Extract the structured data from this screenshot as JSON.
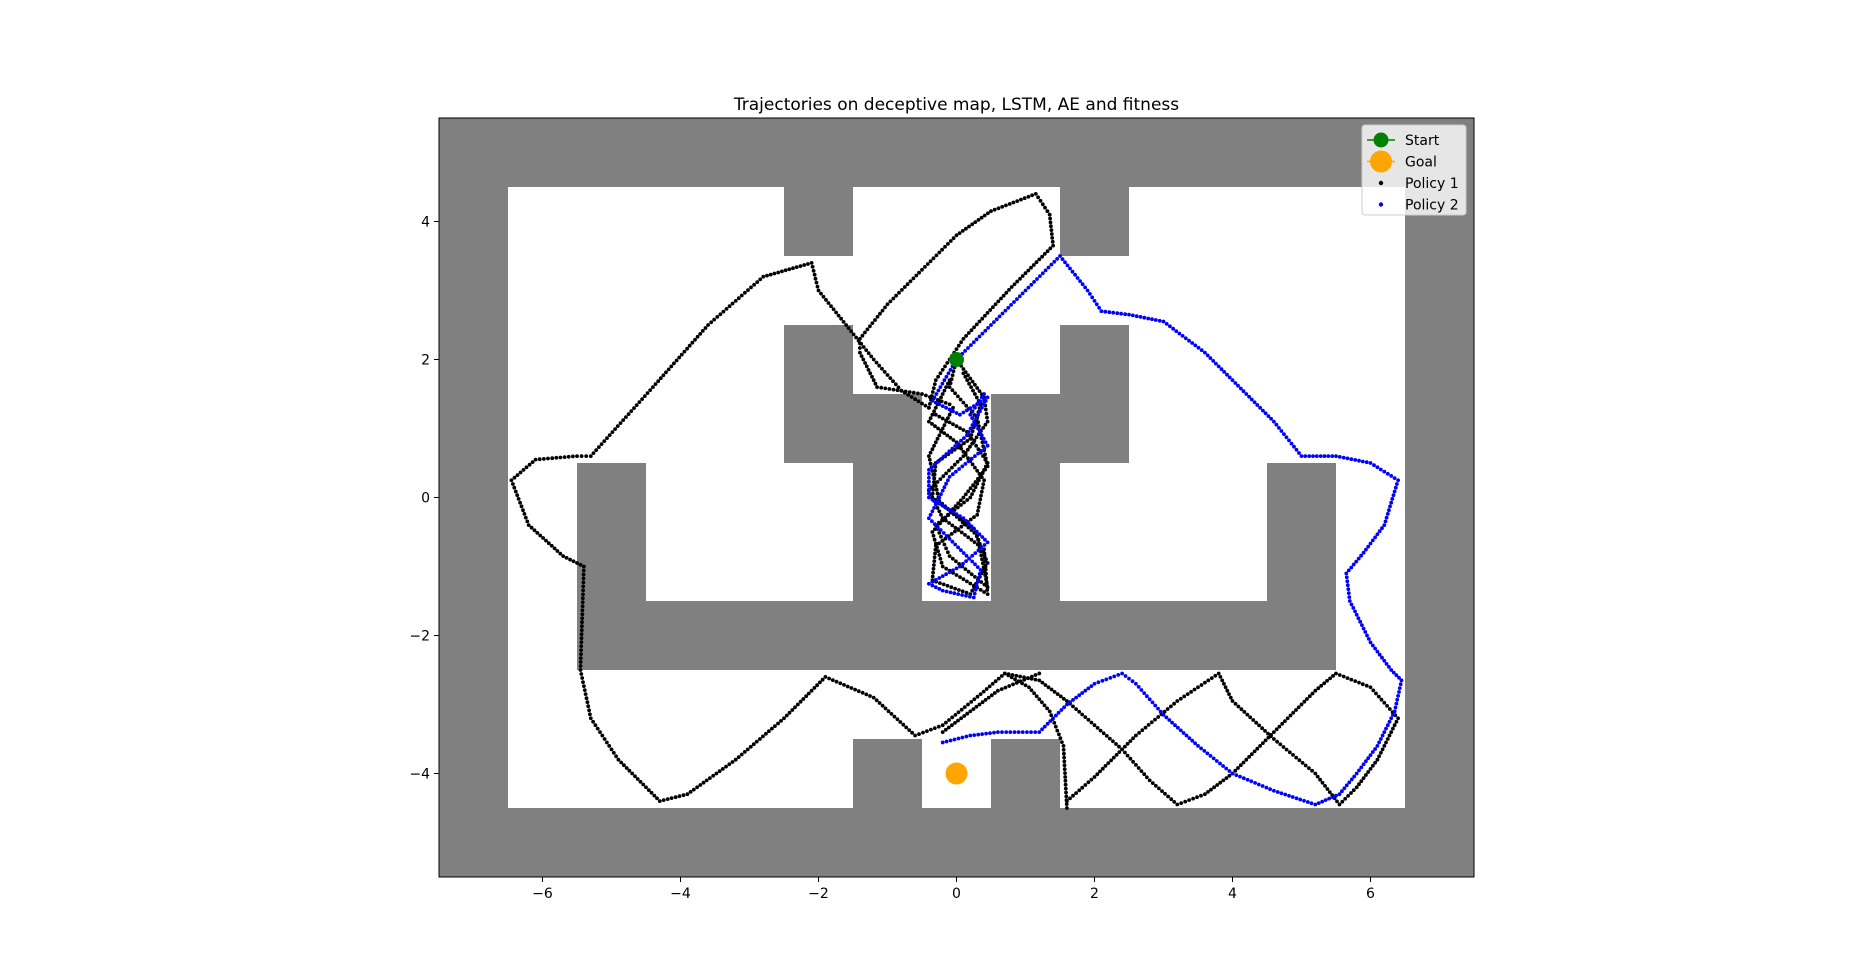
{
  "chart_data": {
    "type": "scatter",
    "title": "Trajectories on deceptive map, LSTM, AE and fitness",
    "xlabel": "",
    "ylabel": "",
    "xlim": [
      -7.5,
      7.5
    ],
    "ylim": [
      -5.5,
      5.5
    ],
    "xticks": [
      {
        "value": -6,
        "label": "−6"
      },
      {
        "value": -4,
        "label": "−4"
      },
      {
        "value": -2,
        "label": "−2"
      },
      {
        "value": 0,
        "label": "0"
      },
      {
        "value": 2,
        "label": "2"
      },
      {
        "value": 4,
        "label": "4"
      },
      {
        "value": 6,
        "label": "6"
      }
    ],
    "yticks": [
      {
        "value": -4,
        "label": "−4"
      },
      {
        "value": -2,
        "label": "−2"
      },
      {
        "value": 0,
        "label": "0"
      },
      {
        "value": 2,
        "label": "2"
      },
      {
        "value": 4,
        "label": "4"
      }
    ],
    "grid": false,
    "legend_position": "upper right",
    "colors": {
      "wall": "#808080",
      "floor": "#ffffff",
      "start": "#008000",
      "goal": "#ffa500",
      "policy1": "#000000",
      "policy2": "#0000ff"
    },
    "walls": [
      {
        "x0": -7.5,
        "x1": 7.5,
        "y0": 4.5,
        "y1": 5.5
      },
      {
        "x0": -7.5,
        "x1": 7.5,
        "y0": -5.5,
        "y1": -4.5
      },
      {
        "x0": -7.5,
        "x1": -6.5,
        "y0": -5.5,
        "y1": 5.5
      },
      {
        "x0": 6.5,
        "x1": 7.5,
        "y0": -5.5,
        "y1": 5.5
      },
      {
        "x0": -2.5,
        "x1": -1.5,
        "y0": 3.5,
        "y1": 4.5
      },
      {
        "x0": 1.5,
        "x1": 2.5,
        "y0": 3.5,
        "y1": 4.5
      },
      {
        "x0": -2.5,
        "x1": -1.5,
        "y0": 0.5,
        "y1": 2.5
      },
      {
        "x0": 1.5,
        "x1": 2.5,
        "y0": 0.5,
        "y1": 2.5
      },
      {
        "x0": -1.5,
        "x1": -0.5,
        "y0": -1.5,
        "y1": 1.5
      },
      {
        "x0": 0.5,
        "x1": 1.5,
        "y0": -1.5,
        "y1": 1.5
      },
      {
        "x0": -5.5,
        "x1": -4.5,
        "y0": -2.5,
        "y1": 0.5
      },
      {
        "x0": 4.5,
        "x1": 5.5,
        "y0": -2.5,
        "y1": 0.5
      },
      {
        "x0": -5.5,
        "x1": 5.5,
        "y0": -2.5,
        "y1": -1.5
      },
      {
        "x0": -1.5,
        "x1": -0.5,
        "y0": -4.5,
        "y1": -3.5
      },
      {
        "x0": 0.5,
        "x1": 1.5,
        "y0": -4.5,
        "y1": -3.5
      }
    ],
    "start": {
      "x": 0,
      "y": 2
    },
    "goal": {
      "x": 0,
      "y": -4
    },
    "legend": [
      {
        "label": "Start",
        "marker": "start"
      },
      {
        "label": "Goal",
        "marker": "goal"
      },
      {
        "label": "Policy 1",
        "marker": "policy1"
      },
      {
        "label": "Policy 2",
        "marker": "policy2"
      }
    ],
    "series": [
      {
        "name": "Policy 1",
        "color": "#000000",
        "trajectories": [
          [
            [
              -0.4,
              1.3
            ],
            [
              -0.8,
              1.55
            ],
            [
              -1.2,
              2.0
            ],
            [
              -2.0,
              3.0
            ],
            [
              -2.1,
              3.4
            ],
            [
              -2.8,
              3.2
            ],
            [
              -3.6,
              2.5
            ],
            [
              -4.4,
              1.6
            ],
            [
              -5.3,
              0.6
            ],
            [
              -5.5,
              0.6
            ],
            [
              -6.1,
              0.55
            ],
            [
              -6.45,
              0.25
            ],
            [
              -6.2,
              -0.4
            ],
            [
              -5.7,
              -0.85
            ],
            [
              -5.4,
              -1.0
            ],
            [
              -5.45,
              -2.5
            ],
            [
              -5.3,
              -3.2
            ],
            [
              -4.9,
              -3.8
            ],
            [
              -4.3,
              -4.4
            ],
            [
              -3.9,
              -4.3
            ],
            [
              -3.2,
              -3.8
            ],
            [
              -2.5,
              -3.2
            ],
            [
              -1.9,
              -2.6
            ],
            [
              -1.2,
              -2.9
            ],
            [
              -0.6,
              -3.45
            ],
            [
              -0.2,
              -3.3
            ],
            [
              0.35,
              -2.85
            ],
            [
              0.7,
              -2.55
            ],
            [
              1.05,
              -2.75
            ],
            [
              1.35,
              -3.1
            ],
            [
              1.55,
              -3.6
            ],
            [
              1.6,
              -4.5
            ]
          ],
          [
            [
              -0.1,
              1.35
            ],
            [
              -0.5,
              1.5
            ],
            [
              -1.15,
              1.6
            ],
            [
              -1.4,
              2.1
            ],
            [
              -1.4,
              2.3
            ],
            [
              -1.0,
              2.8
            ],
            [
              -0.5,
              3.3
            ],
            [
              0,
              3.8
            ],
            [
              0.5,
              4.15
            ],
            [
              1.15,
              4.4
            ],
            [
              1.35,
              4.1
            ],
            [
              1.4,
              3.65
            ],
            [
              0.8,
              3.05
            ],
            [
              0.1,
              2.3
            ],
            [
              -0.3,
              1.7
            ],
            [
              -0.4,
              1.3
            ]
          ],
          [
            [
              0,
              2
            ],
            [
              0.4,
              1.45
            ],
            [
              0.45,
              1.1
            ],
            [
              0.1,
              0.6
            ],
            [
              -0.4,
              0.1
            ],
            [
              -0.2,
              -0.3
            ],
            [
              0.4,
              -0.75
            ],
            [
              0.45,
              -1.4
            ],
            [
              -0.2,
              -1.0
            ],
            [
              -0.35,
              -0.5
            ],
            [
              0.1,
              0.0
            ],
            [
              0.45,
              0.45
            ],
            [
              0.3,
              1.15
            ],
            [
              -0.1,
              1.6
            ],
            [
              0,
              2
            ]
          ],
          [
            [
              0.1,
              1.8
            ],
            [
              0.35,
              1.35
            ],
            [
              0.2,
              0.85
            ],
            [
              -0.3,
              0.5
            ],
            [
              -0.35,
              0.0
            ],
            [
              0.25,
              -0.45
            ],
            [
              0.45,
              -0.95
            ],
            [
              0.2,
              -1.4
            ],
            [
              -0.35,
              -1.2
            ],
            [
              -0.3,
              -0.7
            ],
            [
              0.3,
              -0.25
            ],
            [
              0.4,
              0.25
            ],
            [
              0.0,
              0.8
            ],
            [
              -0.4,
              1.1
            ],
            [
              -0.1,
              1.7
            ]
          ],
          [
            [
              -0.3,
              1.2
            ],
            [
              0.15,
              0.95
            ],
            [
              0.45,
              0.5
            ],
            [
              0.2,
              0.0
            ],
            [
              -0.3,
              -0.4
            ],
            [
              -0.1,
              -0.85
            ],
            [
              0.45,
              -1.3
            ],
            [
              0.3,
              -0.55
            ],
            [
              -0.25,
              -0.05
            ],
            [
              -0.4,
              0.6
            ],
            [
              -0.05,
              1.3
            ]
          ],
          [
            [
              0.7,
              -2.55
            ],
            [
              1.2,
              -2.65
            ],
            [
              1.6,
              -2.95
            ],
            [
              2.0,
              -3.3
            ],
            [
              2.4,
              -3.65
            ],
            [
              2.8,
              -4.1
            ],
            [
              3.2,
              -4.45
            ],
            [
              3.6,
              -4.3
            ],
            [
              4.0,
              -4.0
            ],
            [
              4.4,
              -3.6
            ],
            [
              4.8,
              -3.2
            ],
            [
              5.2,
              -2.8
            ],
            [
              5.5,
              -2.55
            ],
            [
              6.0,
              -2.75
            ],
            [
              6.4,
              -3.2
            ],
            [
              6.1,
              -3.8
            ],
            [
              5.8,
              -4.2
            ],
            [
              5.55,
              -4.45
            ],
            [
              5.2,
              -4.0
            ],
            [
              4.6,
              -3.5
            ],
            [
              4.0,
              -2.95
            ],
            [
              3.8,
              -2.55
            ],
            [
              3.2,
              -2.95
            ],
            [
              2.6,
              -3.45
            ],
            [
              2.0,
              -4.05
            ],
            [
              1.6,
              -4.4
            ]
          ],
          [
            [
              -0.2,
              -3.4
            ],
            [
              0.2,
              -3.1
            ],
            [
              0.6,
              -2.8
            ],
            [
              1.2,
              -2.55
            ]
          ]
        ]
      },
      {
        "name": "Policy 2",
        "color": "#0000ff",
        "trajectories": [
          [
            [
              0,
              2
            ],
            [
              0.5,
              2.5
            ],
            [
              1.0,
              3.0
            ],
            [
              1.5,
              3.5
            ],
            [
              1.9,
              3.0
            ],
            [
              2.1,
              2.7
            ],
            [
              2.5,
              2.65
            ],
            [
              3.0,
              2.55
            ],
            [
              3.6,
              2.1
            ],
            [
              4.2,
              1.5
            ],
            [
              4.6,
              1.1
            ],
            [
              5.0,
              0.6
            ],
            [
              5.5,
              0.6
            ],
            [
              6.0,
              0.5
            ],
            [
              6.4,
              0.25
            ],
            [
              6.2,
              -0.4
            ],
            [
              5.9,
              -0.8
            ],
            [
              5.65,
              -1.1
            ],
            [
              5.7,
              -1.5
            ],
            [
              6.0,
              -2.1
            ],
            [
              6.3,
              -2.5
            ],
            [
              6.45,
              -2.65
            ],
            [
              6.35,
              -3.1
            ],
            [
              6.1,
              -3.6
            ],
            [
              5.8,
              -4.0
            ],
            [
              5.55,
              -4.3
            ],
            [
              5.2,
              -4.45
            ],
            [
              4.6,
              -4.25
            ],
            [
              4.0,
              -4.0
            ],
            [
              3.5,
              -3.6
            ],
            [
              3.0,
              -3.15
            ],
            [
              2.6,
              -2.7
            ],
            [
              2.4,
              -2.55
            ],
            [
              2.0,
              -2.7
            ],
            [
              1.6,
              -3.0
            ],
            [
              1.2,
              -3.4
            ],
            [
              0.6,
              -3.4
            ],
            [
              0.2,
              -3.45
            ],
            [
              -0.2,
              -3.55
            ]
          ],
          [
            [
              0,
              2
            ],
            [
              -0.35,
              1.4
            ],
            [
              0.05,
              1.2
            ],
            [
              0.45,
              1.45
            ],
            [
              0.15,
              0.9
            ],
            [
              -0.4,
              0.4
            ],
            [
              -0.4,
              0.0
            ],
            [
              0.1,
              -0.3
            ],
            [
              0.45,
              -0.65
            ],
            [
              0.05,
              -1.0
            ],
            [
              -0.4,
              -1.25
            ],
            [
              -0.2,
              -1.35
            ],
            [
              0.25,
              -1.45
            ],
            [
              0.35,
              -1.05
            ],
            [
              -0.1,
              -0.6
            ],
            [
              -0.4,
              -0.3
            ],
            [
              -0.1,
              0.3
            ],
            [
              0.45,
              0.75
            ],
            [
              0.2,
              1.2
            ],
            [
              0.4,
              1.5
            ]
          ]
        ]
      }
    ]
  }
}
